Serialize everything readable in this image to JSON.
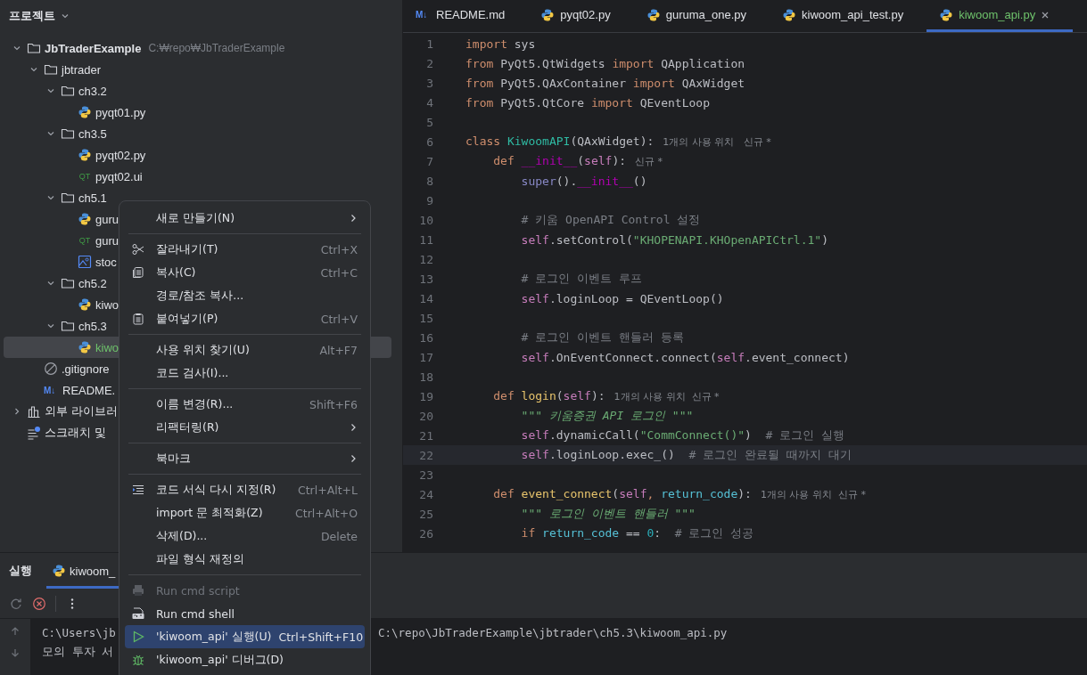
{
  "project": {
    "title": "프로젝트",
    "tree": [
      {
        "name": "JbTraderExample",
        "kind": "folder",
        "bold": true,
        "path": "C:₩repo₩JbTraderExample",
        "expanded": true,
        "selected": false,
        "children": [
          {
            "name": "jbtrader",
            "kind": "folder",
            "expanded": true,
            "selected": false,
            "children": [
              {
                "name": "ch3.2",
                "kind": "folder",
                "expanded": true,
                "selected": false,
                "children": [
                  {
                    "name": "pyqt01.py",
                    "kind": "py",
                    "selected": false
                  }
                ]
              },
              {
                "name": "ch3.5",
                "kind": "folder",
                "expanded": true,
                "selected": false,
                "children": [
                  {
                    "name": "pyqt02.py",
                    "kind": "py",
                    "selected": false
                  },
                  {
                    "name": "pyqt02.ui",
                    "kind": "ui",
                    "icon_text": "QT",
                    "selected": false
                  }
                ]
              },
              {
                "name": "ch5.1",
                "kind": "folder",
                "expanded": true,
                "selected": false,
                "children": [
                  {
                    "name": "guru",
                    "kind": "py",
                    "selected": false
                  },
                  {
                    "name": "guru",
                    "kind": "ui",
                    "icon_text": "QT",
                    "selected": false
                  },
                  {
                    "name": "stoc",
                    "kind": "image",
                    "selected": false
                  }
                ]
              },
              {
                "name": "ch5.2",
                "kind": "folder",
                "expanded": true,
                "selected": false,
                "children": [
                  {
                    "name": "kiwo",
                    "kind": "py",
                    "selected": false
                  }
                ]
              },
              {
                "name": "ch5.3",
                "kind": "folder",
                "expanded": true,
                "selected": false,
                "children": [
                  {
                    "name": "kiwo",
                    "kind": "py",
                    "selected": true
                  }
                ]
              }
            ]
          },
          {
            "name": ".gitignore",
            "kind": "ignore",
            "selected": false
          },
          {
            "name": "README.",
            "kind": "md",
            "icon_text": "M↓",
            "selected": false
          }
        ]
      },
      {
        "name": "외부 라이브러",
        "kind": "lib",
        "expanded": false,
        "selected": false
      },
      {
        "name": "스크래치 및",
        "kind": "scratch",
        "selected": false
      }
    ]
  },
  "tabs": [
    {
      "label": "README.md",
      "kind": "md",
      "icon_text": "M↓",
      "selected": false
    },
    {
      "label": "pyqt02.py",
      "kind": "py",
      "selected": false
    },
    {
      "label": "guruma_one.py",
      "kind": "py",
      "selected": false
    },
    {
      "label": "kiwoom_api_test.py",
      "kind": "py",
      "selected": false
    },
    {
      "label": "kiwoom_api.py",
      "kind": "py",
      "selected": true
    }
  ],
  "code": [
    {
      "n": "1",
      "current": false,
      "tokens": [
        {
          "t": "import",
          "kind": "kw"
        },
        {
          "t": " sys",
          "kind": "plain"
        }
      ]
    },
    {
      "n": "2",
      "current": false,
      "tokens": [
        {
          "t": "from",
          "kind": "kw"
        },
        {
          "t": " PyQt5.QtWidgets ",
          "kind": "plain"
        },
        {
          "t": "import",
          "kind": "kw"
        },
        {
          "t": " QApplication",
          "kind": "plain"
        }
      ]
    },
    {
      "n": "3",
      "current": false,
      "tokens": [
        {
          "t": "from",
          "kind": "kw"
        },
        {
          "t": " PyQt5.QAxContainer ",
          "kind": "plain"
        },
        {
          "t": "import",
          "kind": "kw"
        },
        {
          "t": " QAxWidget",
          "kind": "plain"
        }
      ]
    },
    {
      "n": "4",
      "current": false,
      "tokens": [
        {
          "t": "from",
          "kind": "kw"
        },
        {
          "t": " PyQt5.QtCore ",
          "kind": "plain"
        },
        {
          "t": "import",
          "kind": "kw"
        },
        {
          "t": " QEventLoop",
          "kind": "plain"
        }
      ]
    },
    {
      "n": "5",
      "current": false
    },
    {
      "n": "6",
      "current": false,
      "tokens": [
        {
          "t": "class",
          "kind": "kw"
        },
        {
          "t": " KiwoomAPI",
          "kind": "cls"
        },
        {
          "t": "(QAxWidget):",
          "kind": "plain"
        },
        {
          "t": "1개의 사용 위치   신규 *",
          "kind": "hint"
        }
      ],
      "children": [
        {
          "n": "7",
          "current": false,
          "tokens": [
            {
              "t": "def",
              "kind": "kw"
            },
            {
              "t": " __init__",
              "kind": "dunder"
            },
            {
              "t": "(",
              "kind": "plain"
            },
            {
              "t": "self",
              "kind": "self"
            },
            {
              "t": "):",
              "kind": "plain"
            },
            {
              "t": "신규 *",
              "kind": "hint"
            }
          ],
          "children": [
            {
              "n": "8",
              "current": false,
              "tokens": [
                {
                  "t": "super",
                  "kind": "builtin"
                },
                {
                  "t": "().",
                  "kind": "plain"
                },
                {
                  "t": "__init__",
                  "kind": "dunder"
                },
                {
                  "t": "()",
                  "kind": "plain"
                }
              ]
            },
            {
              "n": "9",
              "current": false
            },
            {
              "n": "10",
              "current": false,
              "tokens": [
                {
                  "t": "# 키움 OpenAPI Control 설정",
                  "kind": "com"
                }
              ]
            },
            {
              "n": "11",
              "current": false,
              "tokens": [
                {
                  "t": "self",
                  "kind": "self"
                },
                {
                  "t": ".setControl(",
                  "kind": "plain"
                },
                {
                  "t": "\"KHOPENAPI.KHOpenAPICtrl.1\"",
                  "kind": "str"
                },
                {
                  "t": ")",
                  "kind": "plain"
                }
              ]
            },
            {
              "n": "12",
              "current": false
            },
            {
              "n": "13",
              "current": false,
              "tokens": [
                {
                  "t": "# 로그인 이벤트 루프",
                  "kind": "com"
                }
              ]
            },
            {
              "n": "14",
              "current": false,
              "tokens": [
                {
                  "t": "self",
                  "kind": "self"
                },
                {
                  "t": ".loginLoop = QEventLoop()",
                  "kind": "plain"
                }
              ]
            },
            {
              "n": "15",
              "current": false
            },
            {
              "n": "16",
              "current": false,
              "tokens": [
                {
                  "t": "# 로그인 이벤트 핸들러 등록",
                  "kind": "com"
                }
              ]
            },
            {
              "n": "17",
              "current": false,
              "tokens": [
                {
                  "t": "self",
                  "kind": "self"
                },
                {
                  "t": ".OnEventConnect.connect(",
                  "kind": "plain"
                },
                {
                  "t": "self",
                  "kind": "self"
                },
                {
                  "t": ".event_connect)",
                  "kind": "plain"
                }
              ]
            }
          ]
        },
        {
          "n": "18",
          "current": false
        },
        {
          "n": "19",
          "current": false,
          "tokens": [
            {
              "t": "def",
              "kind": "kw"
            },
            {
              "t": " login",
              "kind": "fn"
            },
            {
              "t": "(",
              "kind": "plain"
            },
            {
              "t": "self",
              "kind": "self"
            },
            {
              "t": "):",
              "kind": "plain"
            },
            {
              "t": "1개의 사용 위치  신규 *",
              "kind": "hint"
            }
          ],
          "children": [
            {
              "n": "20",
              "current": false,
              "tokens": [
                {
                  "t": "\"\"\" 키움증권 API 로그인 \"\"\"",
                  "kind": "doc"
                }
              ]
            },
            {
              "n": "21",
              "current": false,
              "tokens": [
                {
                  "t": "self",
                  "kind": "self"
                },
                {
                  "t": ".dynamicCall(",
                  "kind": "plain"
                },
                {
                  "t": "\"CommConnect()\"",
                  "kind": "str"
                },
                {
                  "t": ")  ",
                  "kind": "plain"
                },
                {
                  "t": "# 로그인 실행",
                  "kind": "com"
                }
              ]
            },
            {
              "n": "22",
              "current": true,
              "tokens": [
                {
                  "t": "self",
                  "kind": "self"
                },
                {
                  "t": ".loginLoop.exec_()  ",
                  "kind": "plain"
                },
                {
                  "t": "# 로그인 완료될 때까지 대기",
                  "kind": "com"
                }
              ]
            }
          ]
        },
        {
          "n": "23",
          "current": false
        },
        {
          "n": "24",
          "current": false,
          "tokens": [
            {
              "t": "def",
              "kind": "kw"
            },
            {
              "t": " event_connect",
              "kind": "fn"
            },
            {
              "t": "(",
              "kind": "plain"
            },
            {
              "t": "self",
              "kind": "self"
            },
            {
              "t": ", ",
              "kind": "kw"
            },
            {
              "t": "return_code",
              "kind": "param"
            },
            {
              "t": "):",
              "kind": "plain"
            },
            {
              "t": "1개의 사용 위치  신규 *",
              "kind": "hint"
            }
          ],
          "children": [
            {
              "n": "25",
              "current": false,
              "tokens": [
                {
                  "t": "\"\"\" 로그인 이벤트 핸들러 \"\"\"",
                  "kind": "doc"
                }
              ]
            },
            {
              "n": "26",
              "current": false,
              "tokens": [
                {
                  "t": "if",
                  "kind": "kw"
                },
                {
                  "t": " return_code",
                  "kind": "param"
                },
                {
                  "t": " == ",
                  "kind": "plain"
                },
                {
                  "t": "0",
                  "kind": "num"
                },
                {
                  "t": ":  ",
                  "kind": "plain"
                },
                {
                  "t": "# 로그인 성공",
                  "kind": "com"
                }
              ]
            }
          ]
        }
      ]
    }
  ],
  "run_panel": {
    "title": "실행",
    "tab": "kiwoom_",
    "console": [
      {
        "parts": [
          "C:\\Users\\jb",
          "C:\\repo\\JbTraderExample\\jbtrader\\ch5.3\\kiwoom_api.py"
        ]
      },
      {
        "parts": [
          "모의 투자 서"
        ]
      }
    ]
  },
  "context_menu": {
    "groups": [
      [
        {
          "label": "새로 만들기(N)",
          "kind": "plain",
          "submenu": true,
          "disabled": false,
          "selected": false
        }
      ],
      [
        {
          "label": "잘라내기(T)",
          "kind": "cut",
          "shortcut": "Ctrl+X",
          "submenu": false,
          "disabled": false,
          "selected": false
        },
        {
          "label": "복사(C)",
          "kind": "copy",
          "shortcut": "Ctrl+C",
          "submenu": false,
          "disabled": false,
          "selected": false
        },
        {
          "label": "경로/참조 복사...",
          "kind": "plain",
          "submenu": false,
          "disabled": false,
          "selected": false
        },
        {
          "label": "붙여넣기(P)",
          "kind": "paste",
          "shortcut": "Ctrl+V",
          "submenu": false,
          "disabled": false,
          "selected": false
        }
      ],
      [
        {
          "label": "사용 위치 찾기(U)",
          "kind": "plain",
          "shortcut": "Alt+F7",
          "submenu": false,
          "disabled": false,
          "selected": false
        },
        {
          "label": "코드 검사(I)...",
          "kind": "plain",
          "submenu": false,
          "disabled": false,
          "selected": false
        }
      ],
      [
        {
          "label": "이름 변경(R)...",
          "kind": "plain",
          "shortcut": "Shift+F6",
          "submenu": false,
          "disabled": false,
          "selected": false
        },
        {
          "label": "리팩터링(R)",
          "kind": "plain",
          "submenu": true,
          "disabled": false,
          "selected": false
        }
      ],
      [
        {
          "label": "북마크",
          "kind": "plain",
          "submenu": true,
          "disabled": false,
          "selected": false
        }
      ],
      [
        {
          "label": "코드 서식 다시 지정(R)",
          "kind": "format",
          "shortcut": "Ctrl+Alt+L",
          "submenu": false,
          "disabled": false,
          "selected": false
        },
        {
          "label": "import 문 최적화(Z)",
          "kind": "plain",
          "shortcut": "Ctrl+Alt+O",
          "submenu": false,
          "disabled": false,
          "selected": false
        },
        {
          "label": "삭제(D)...",
          "kind": "plain",
          "shortcut": "Delete",
          "submenu": false,
          "disabled": false,
          "selected": false
        },
        {
          "label": "파일 형식 재정의",
          "kind": "plain",
          "submenu": false,
          "disabled": false,
          "selected": false
        }
      ],
      [
        {
          "label": "Run cmd script",
          "kind": "printer",
          "submenu": false,
          "disabled": true,
          "selected": false
        },
        {
          "label": "Run cmd shell",
          "kind": "cmd",
          "submenu": false,
          "disabled": false,
          "selected": false
        },
        {
          "label": "'kiwoom_api' 실행(U)",
          "kind": "run",
          "shortcut": "Ctrl+Shift+F10",
          "submenu": false,
          "disabled": false,
          "selected": true
        },
        {
          "label": "'kiwoom_api' 디버그(D)",
          "kind": "bug",
          "submenu": false,
          "disabled": false,
          "selected": false
        }
      ]
    ]
  }
}
